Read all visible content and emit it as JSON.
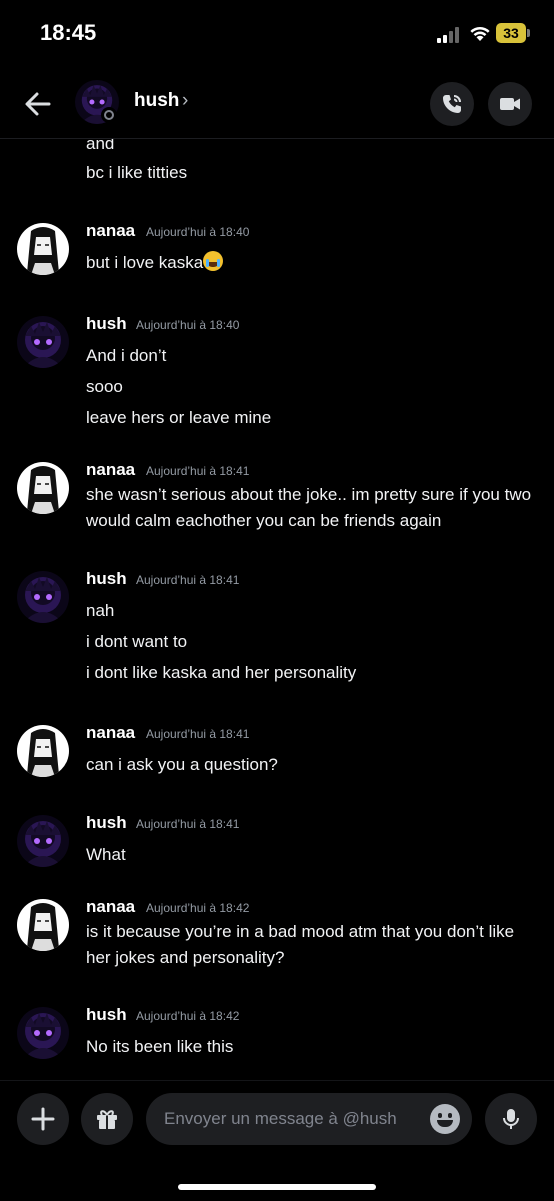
{
  "status_bar": {
    "time": "18:45",
    "battery": "33"
  },
  "header": {
    "name": "hush",
    "chevron": "›"
  },
  "partial_message": {
    "text": "and"
  },
  "messages": [
    {
      "author": "",
      "timestamp": "",
      "lines": [
        "bc i like titties"
      ]
    },
    {
      "author": "nanaa",
      "timestamp": "Aujourd’hui à 18:40",
      "lines": [
        "but i love kaska"
      ],
      "emoji": "loudly-crying-face-emoji"
    },
    {
      "author": "hush",
      "timestamp": "Aujourd’hui à 18:40",
      "lines": [
        "And i don’t",
        "sooo",
        "leave hers or leave mine"
      ]
    },
    {
      "author": "nanaa",
      "timestamp": "Aujourd’hui à 18:41",
      "lines": [
        "she wasn’t serious about the joke.. im pretty sure if you two would calm eachother you can be friends again"
      ]
    },
    {
      "author": "hush",
      "timestamp": "Aujourd’hui à 18:41",
      "lines": [
        "nah",
        "i dont want to",
        "i dont like kaska and her personality"
      ]
    },
    {
      "author": "nanaa",
      "timestamp": "Aujourd’hui à 18:41",
      "lines": [
        "can i ask you a question?"
      ]
    },
    {
      "author": "hush",
      "timestamp": "Aujourd’hui à 18:41",
      "lines": [
        "What"
      ]
    },
    {
      "author": "nanaa",
      "timestamp": "Aujourd’hui à 18:42",
      "lines": [
        "is it because you’re in a bad mood atm that you don’t like her jokes and personality?"
      ]
    },
    {
      "author": "hush",
      "timestamp": "Aujourd’hui à 18:42",
      "lines": [
        "No its been like this"
      ]
    }
  ],
  "composer": {
    "placeholder": "Envoyer un message à @hush"
  },
  "colors": {
    "background": "#000000",
    "surface": "#1e1f22",
    "muted": "#949ba4",
    "hush_avatar": "#7b3fe4"
  }
}
